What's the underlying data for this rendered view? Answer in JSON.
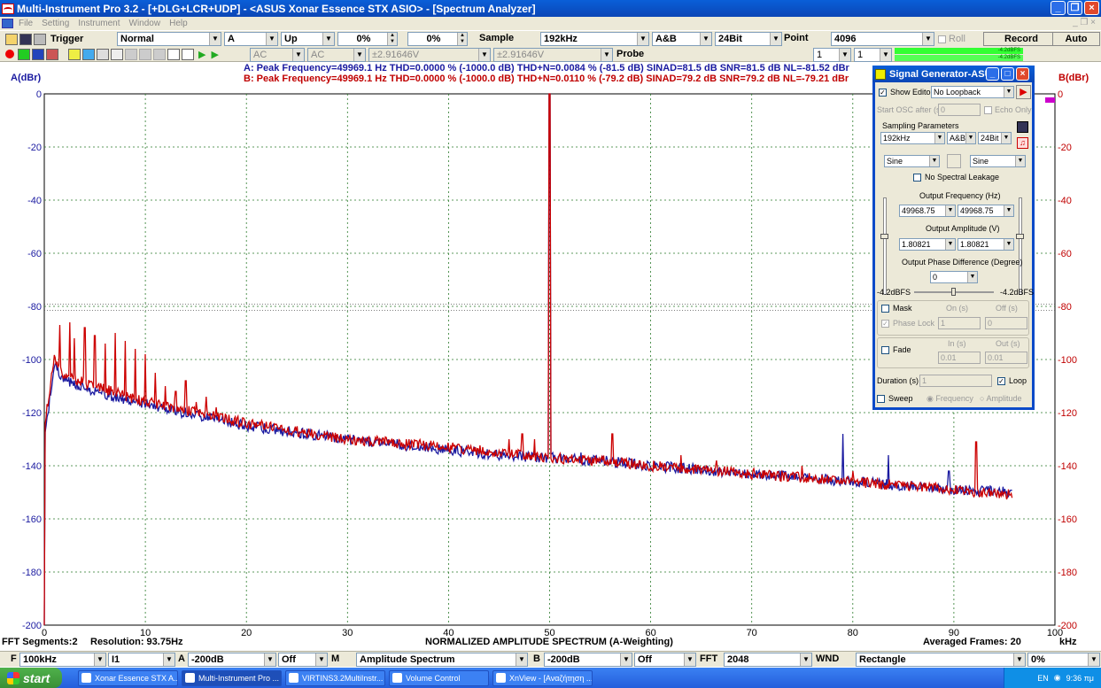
{
  "window": {
    "title": "Multi-Instrument Pro 3.2   -  [+DLG+LCR+UDP]   -  <ASUS Xonar Essence STX ASIO> - [Spectrum Analyzer]"
  },
  "menu": [
    "File",
    "Setting",
    "Instrument",
    "Window",
    "Help"
  ],
  "toolbar1": {
    "trigger_label": "Trigger",
    "trigger_mode": "Normal",
    "trigger_channel": "A",
    "trigger_edge": "Up",
    "pct1": "0%",
    "pct2": "0%",
    "sample_label": "Sample",
    "sample_rate": "192kHz",
    "channels": "A&B",
    "bits": "24Bit",
    "point_label": "Point",
    "points": "4096",
    "roll_label": "Roll",
    "record_label": "Record",
    "auto_label": "Auto"
  },
  "toolbar2": {
    "coupling_a": "AC",
    "coupling_b": "AC",
    "range_a": "±2.91646V",
    "range_b": "±2.91646V",
    "probe_label": "Probe",
    "probe_a": "1",
    "probe_b": "1",
    "meter_a": "-4.2dBFS",
    "meter_b": "-4.2dBFS"
  },
  "readout": {
    "a": "A: Peak Frequency=49969.1 Hz  THD=0.0000 % (-1000.0 dB)  THD+N=0.0084 % (-81.5 dB)  SINAD=81.5 dB  SNR=81.5 dB  NL=-81.52 dBr",
    "b": "B: Peak Frequency=49969.1 Hz  THD=0.0000 % (-1000.0 dB)  THD+N=0.0110 % (-79.2 dB)  SINAD=79.2 dB  SNR=79.2 dB  NL=-79.21 dBr"
  },
  "chart_data": {
    "type": "line",
    "title": "NORMALIZED AMPLITUDE SPECTRUM (A-Weighting)",
    "xlabel": "kHz",
    "ylabel_left": "A(dBr)",
    "ylabel_right": "B(dBr)",
    "xlim": [
      0,
      100
    ],
    "ylim": [
      -200,
      0
    ],
    "x_ticks": [
      0,
      10,
      20,
      30,
      40,
      50,
      60,
      70,
      80,
      90,
      100
    ],
    "y_ticks": [
      0,
      -20,
      -40,
      -60,
      -80,
      -100,
      -120,
      -140,
      -160,
      -180,
      -200
    ],
    "grid": true,
    "reference_lines_db": [
      -79.2,
      -81.5
    ],
    "series": [
      {
        "name": "A",
        "color": "#1a1aa0",
        "baseline_x": [
          0,
          1,
          2,
          5,
          10,
          15,
          20,
          30,
          40,
          45,
          50,
          55,
          60,
          70,
          80,
          90,
          95.8
        ],
        "baseline_y": [
          -130,
          -102,
          -108,
          -112,
          -117,
          -121,
          -125,
          -130,
          -134,
          -136,
          -137,
          -138,
          -140,
          -143,
          -146,
          -149,
          -150
        ],
        "spikes_x": [
          50,
          53.1,
          79,
          83.5,
          89.5,
          96
        ],
        "spikes_y": [
          0,
          -135,
          -128,
          -136,
          -142,
          -145
        ]
      },
      {
        "name": "B",
        "color": "#cc0000",
        "baseline_x": [
          0,
          1,
          2,
          5,
          10,
          15,
          20,
          30,
          40,
          45,
          50,
          55,
          60,
          70,
          80,
          90,
          95.8
        ],
        "baseline_y": [
          -125,
          -100,
          -106,
          -110,
          -116,
          -120,
          -124,
          -130,
          -133,
          -135,
          -137,
          -138,
          -140,
          -143,
          -146,
          -149,
          -151
        ],
        "spikes_x": [
          1.5,
          2.5,
          3,
          4,
          5,
          6,
          7,
          8,
          9,
          10,
          11,
          12,
          13,
          14,
          15,
          16,
          17,
          18,
          46,
          47.3,
          48.5,
          50,
          56.2,
          63,
          66.5,
          75,
          80,
          92.2
        ],
        "spikes_y": [
          -87,
          -86,
          -92,
          -88,
          -91,
          -94,
          -90,
          -93,
          -96,
          -98,
          -105,
          -110,
          -112,
          -108,
          -116,
          -114,
          -118,
          -121,
          -130,
          -128,
          -130,
          0,
          -128,
          -136,
          -138,
          -140,
          -142,
          -131
        ]
      }
    ]
  },
  "bottom_info": {
    "segments": "FFT Segments:2",
    "resolution": "Resolution: 93.75Hz",
    "averaged": "Averaged Frames: 20"
  },
  "bottombar": {
    "f_label": "F",
    "f_value": "100kHz",
    "zoom": "I1",
    "a_label": "A",
    "a_floor": "-200dB",
    "a_off": "Off",
    "m_label": "M",
    "m_value": "Amplitude Spectrum",
    "b_label": "B",
    "b_floor": "-200dB",
    "b_off": "Off",
    "fft_label": "FFT",
    "fft_value": "2048",
    "wnd_label": "WND",
    "wnd_value": "Rectangle",
    "overlap": "0%"
  },
  "taskbar": {
    "start": "start",
    "tasks": [
      "Xonar Essence STX A...",
      "Multi-Instrument Pro ...",
      "VIRTINS3.2MultiInstr...",
      "Volume Control",
      "XnView - [Αναζήτηση ..."
    ],
    "lang": "EN",
    "clock": "9:36 πμ"
  },
  "siggen": {
    "title": "Signal Generator-ASU...",
    "show_editor": "Show Editor",
    "loopback": "No Loopback",
    "start_osc": "Start OSC after (s)",
    "start_osc_value": "0",
    "echo_only": "Echo Only",
    "sampling_params": "Sampling Parameters",
    "rate": "192kHz",
    "channels": "A&B",
    "bits": "24Bit",
    "wave_a": "Sine",
    "wave_b": "Sine",
    "no_leakage": "No Spectral Leakage",
    "freq_label": "Output Frequency (Hz)",
    "freq_a": "49968.75",
    "freq_b": "49968.75",
    "amp_label": "Output Amplitude (V)",
    "amp_a": "1.80821",
    "amp_b": "1.80821",
    "phase_label": "Output Phase Difference (Degree)",
    "phase": "0",
    "level_a": "-4.2dBFS",
    "level_b": "-4.2dBFS",
    "mask": "Mask",
    "on_s": "On (s)",
    "off_s": "Off (s)",
    "phase_lock": "Phase Lock",
    "phase_lock_value": "1",
    "off_value": "0",
    "fade": "Fade",
    "in_s": "In (s)",
    "out_s": "Out (s)",
    "fade_in": "0.01",
    "fade_out": "0.01",
    "duration": "Duration (s)",
    "duration_value": "1",
    "loop": "Loop",
    "sweep": "Sweep",
    "sweep_freq": "Frequency",
    "sweep_amp": "Amplitude"
  }
}
